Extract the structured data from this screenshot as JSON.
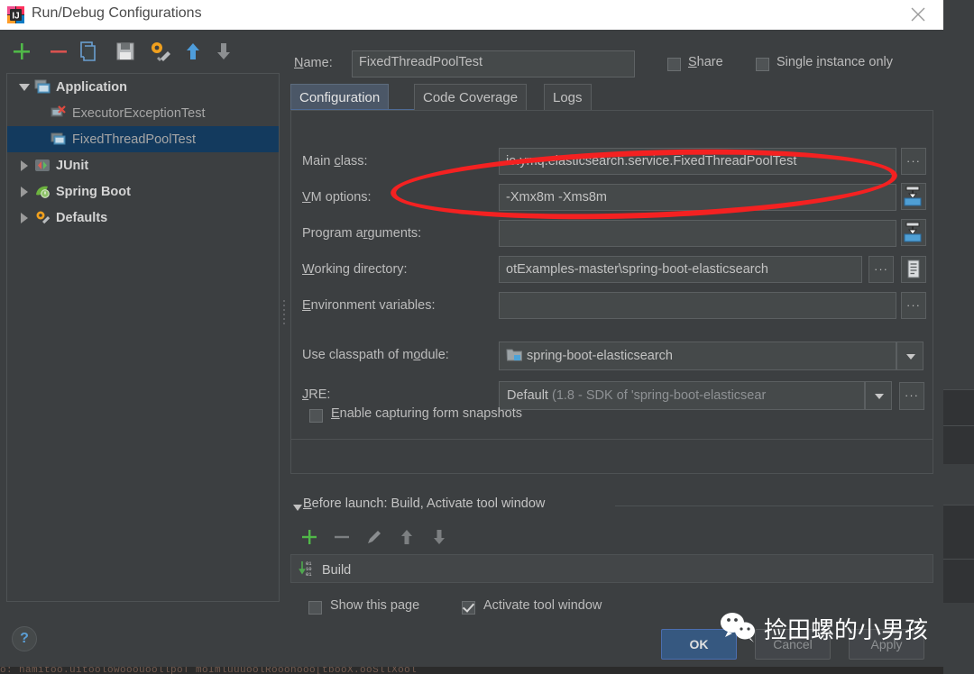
{
  "window": {
    "title": "Run/Debug Configurations",
    "app_icon": "intellij-idea-icon",
    "close_icon": "close-icon"
  },
  "toolbar": {
    "items": [
      {
        "name": "add-configuration-button",
        "icon": "plus-icon"
      },
      {
        "name": "remove-configuration-button",
        "icon": "minus-icon"
      },
      {
        "name": "copy-configuration-button",
        "icon": "copy-icon"
      },
      {
        "name": "save-configuration-button",
        "icon": "save-icon"
      },
      {
        "name": "edit-defaults-button",
        "icon": "gear-wrench-icon"
      },
      {
        "name": "move-up-button",
        "icon": "arrow-up-icon"
      },
      {
        "name": "move-down-button",
        "icon": "arrow-down-icon"
      }
    ],
    "overflow_label": "»"
  },
  "tree": {
    "nodes": [
      {
        "label": "Application",
        "icon": "application-icon",
        "expanded": true,
        "level": 0,
        "bold": true,
        "selected": false,
        "twisty": "down"
      },
      {
        "label": "ExecutorExceptionTest",
        "icon": "application-error-icon",
        "expanded": false,
        "level": 1,
        "bold": false,
        "selected": false,
        "twisty": "none"
      },
      {
        "label": "FixedThreadPoolTest",
        "icon": "application-icon",
        "expanded": false,
        "level": 1,
        "bold": false,
        "selected": true,
        "twisty": "none"
      },
      {
        "label": "JUnit",
        "icon": "junit-icon",
        "expanded": false,
        "level": 0,
        "bold": true,
        "selected": false,
        "twisty": "right"
      },
      {
        "label": "Spring Boot",
        "icon": "spring-boot-icon",
        "expanded": false,
        "level": 0,
        "bold": true,
        "selected": false,
        "twisty": "right"
      },
      {
        "label": "Defaults",
        "icon": "gear-wrench-icon",
        "expanded": false,
        "level": 0,
        "bold": true,
        "selected": false,
        "twisty": "right"
      }
    ]
  },
  "header": {
    "name_label": "Name:",
    "name_value": "FixedThreadPoolTest",
    "share_label": "Share",
    "share_checked": false,
    "single_instance_label": "Single instance only",
    "single_instance_checked": false
  },
  "tabs": [
    {
      "label": "Configuration",
      "active": true
    },
    {
      "label": "Code Coverage",
      "active": false
    },
    {
      "label": "Logs",
      "active": false
    }
  ],
  "form": {
    "main_class": {
      "label": "Main class:",
      "value": "io.ymq.elasticsearch.service.FixedThreadPoolTest",
      "browse": "···"
    },
    "vm_options": {
      "label": "VM options:",
      "value": "-Xmx8m -Xms8m",
      "expand_icon": "expand-field-icon"
    },
    "program_arguments": {
      "label": "Program arguments:",
      "value": "",
      "expand_icon": "expand-field-icon"
    },
    "working_directory": {
      "label": "Working directory:",
      "value": "otExamples-master\\spring-boot-elasticsearch",
      "browse": "···",
      "macro_icon": "insert-macro-icon"
    },
    "environment_variables": {
      "label": "Environment variables:",
      "value": "",
      "browse": "···"
    },
    "classpath_module": {
      "label": "Use classpath of module:",
      "value": "spring-boot-elasticsearch",
      "icon": "module-icon"
    },
    "jre": {
      "label": "JRE:",
      "value_primary": "Default ",
      "value_secondary": "(1.8 - SDK of 'spring-boot-elasticsear",
      "browse": "···"
    },
    "form_snapshots": {
      "label": "Enable capturing form snapshots",
      "checked": false
    }
  },
  "before_launch": {
    "header": "Before launch: Build, Activate tool window",
    "toolbar": [
      {
        "name": "add-task-button",
        "icon": "plus-icon",
        "enabled": true
      },
      {
        "name": "remove-task-button",
        "icon": "minus-icon",
        "enabled": false
      },
      {
        "name": "edit-task-button",
        "icon": "pencil-icon",
        "enabled": false
      },
      {
        "name": "move-task-up-button",
        "icon": "arrow-up-icon",
        "enabled": false
      },
      {
        "name": "move-task-down-button",
        "icon": "arrow-down-icon",
        "enabled": false
      }
    ],
    "tasks": [
      {
        "label": "Build",
        "icon": "build-icon"
      }
    ],
    "show_page": {
      "label": "Show this page",
      "checked": false
    },
    "activate_tool_window": {
      "label": "Activate tool window",
      "checked": true
    }
  },
  "footer": {
    "help_label": "?",
    "ok_label": "OK",
    "cancel_label": "Cancel",
    "apply_label": "Apply"
  },
  "annotations": {
    "highlight_ellipse_color": "#f42121",
    "watermark_text": "捡田螺的小男孩",
    "watermark_icon": "wechat-icon"
  },
  "background": {
    "console_text": "o: namitoo.uitoolowooouoollpoT  moImluuuoolRooonooo[tbooX.ooSllXool"
  }
}
